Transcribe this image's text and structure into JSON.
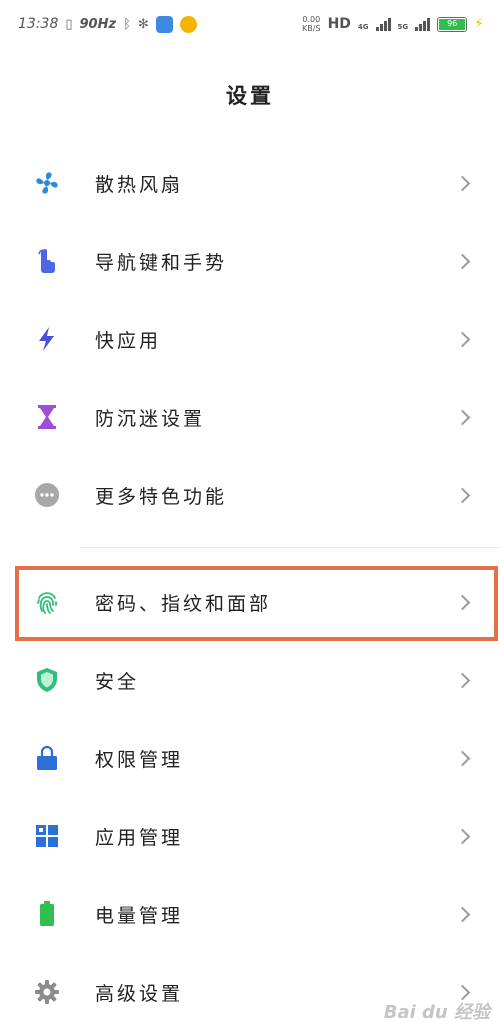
{
  "status_bar": {
    "time": "13:38",
    "refresh_rate": "90Hz",
    "net_speed_value": "0.00",
    "net_speed_unit": "KB/S",
    "hd_label": "HD",
    "net_4g": "4G",
    "net_5g": "5G",
    "battery_level": "96"
  },
  "header": {
    "title": "设置"
  },
  "items": [
    {
      "label": "散热风扇",
      "icon": "fan-icon",
      "color": "#2b8ad8"
    },
    {
      "label": "导航键和手势",
      "icon": "hand-gesture-icon",
      "color": "#4d67e6"
    },
    {
      "label": "快应用",
      "icon": "lightning-icon",
      "color": "#4b4fd6"
    },
    {
      "label": "防沉迷设置",
      "icon": "hourglass-icon",
      "color": "#a04ed8"
    },
    {
      "label": "更多特色功能",
      "icon": "more-dots-icon",
      "color": "#9e9e9e"
    },
    {
      "label": "密码、指纹和面部",
      "icon": "fingerprint-icon",
      "color": "#2fbf7a"
    },
    {
      "label": "安全",
      "icon": "shield-icon",
      "color": "#2fbf7a"
    },
    {
      "label": "权限管理",
      "icon": "lock-icon",
      "color": "#2b6fd8"
    },
    {
      "label": "应用管理",
      "icon": "apps-grid-icon",
      "color": "#2b6fd8"
    },
    {
      "label": "电量管理",
      "icon": "battery-icon",
      "color": "#2fbf4f"
    },
    {
      "label": "高级设置",
      "icon": "gear-icon",
      "color": "#8c8c8c"
    }
  ],
  "watermark": "Bai du 经验"
}
